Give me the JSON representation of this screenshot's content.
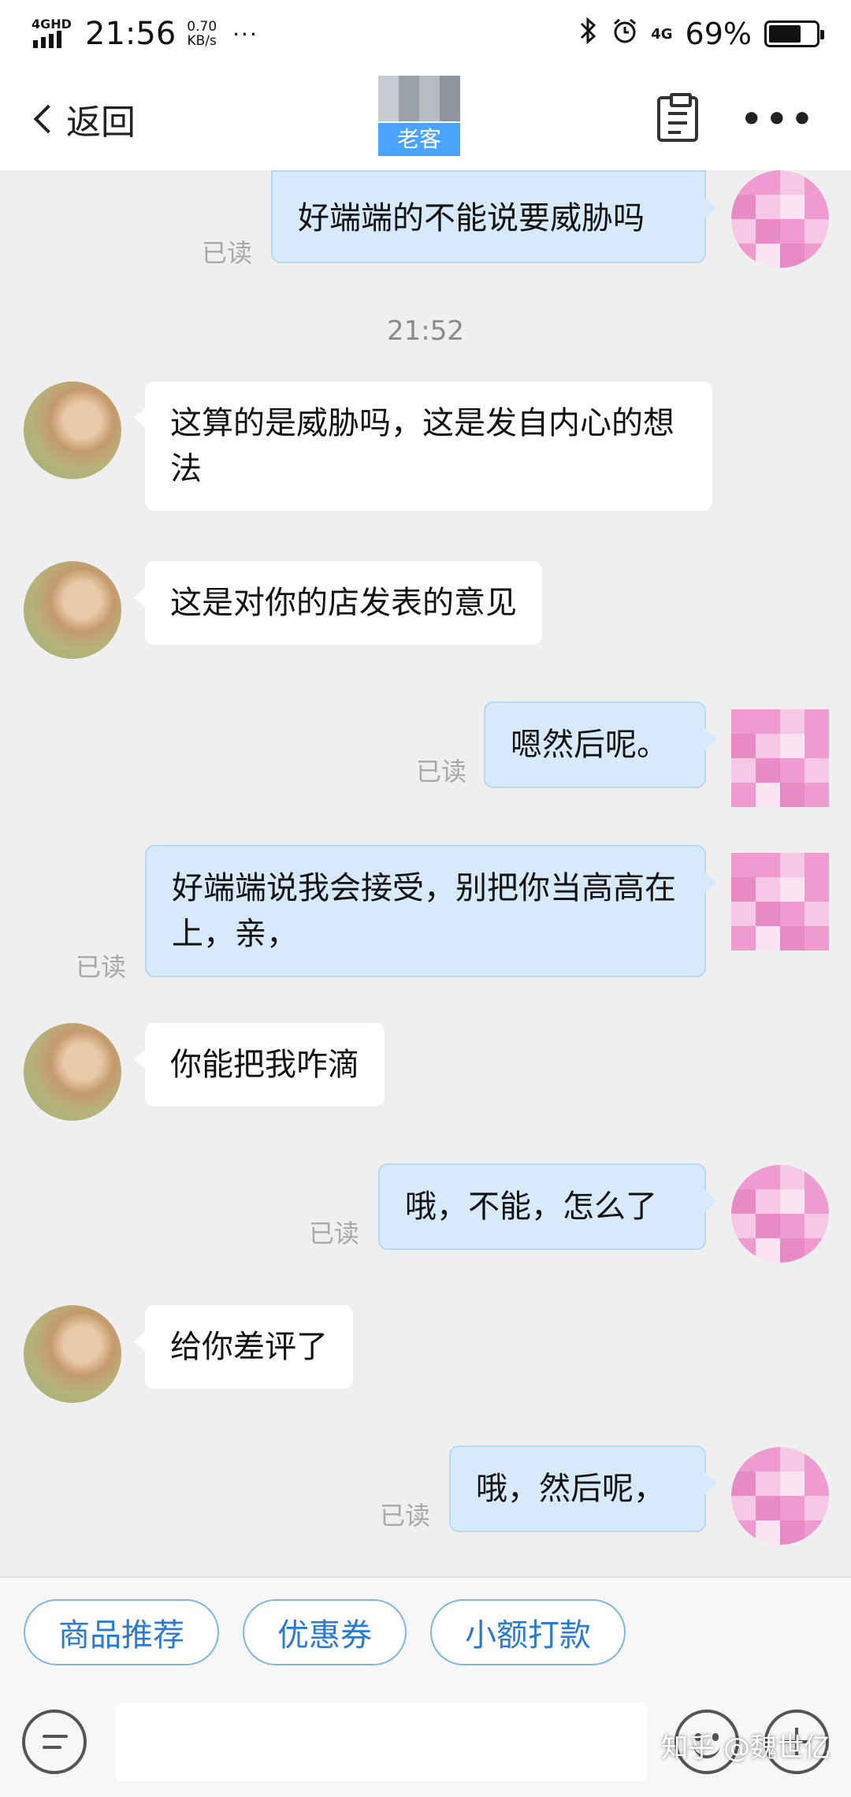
{
  "status_bar": {
    "network": "4GHD",
    "time": "21:56",
    "speed_value": "0.70",
    "speed_unit": "KB/s",
    "dots": "···",
    "network_right": "4G",
    "battery": "69%",
    "battery_level": 0.69
  },
  "nav": {
    "back_label": "返回",
    "tag": "老客"
  },
  "messages": [
    {
      "side": "out",
      "text": "好端端的不能说要威胁吗",
      "read": "已读"
    },
    {
      "timestamp": "21:52"
    },
    {
      "side": "in",
      "text": "这算的是威胁吗，这是发自内心的想法"
    },
    {
      "side": "in",
      "text": "这是对你的店发表的意见"
    },
    {
      "side": "out",
      "text": "嗯然后呢。",
      "read": "已读"
    },
    {
      "side": "out",
      "text": "好端端说我会接受，别把你当高高在上，亲，",
      "read": "已读"
    },
    {
      "side": "in",
      "text": "你能把我咋滴"
    },
    {
      "side": "out",
      "text": "哦，不能，怎么了",
      "read": "已读"
    },
    {
      "side": "in",
      "text": "给你差评了"
    },
    {
      "side": "out",
      "text": "哦，然后呢，",
      "read": "已读"
    }
  ],
  "quick_actions": [
    "商品推荐",
    "优惠券",
    "小额打款"
  ],
  "watermark": "知乎 @魏世亿",
  "colors": {
    "out_bubble": "#d6eafc",
    "in_bubble": "#ffffff",
    "chip_text": "#2b7bd3",
    "tag_bg": "#4aa3ff"
  }
}
